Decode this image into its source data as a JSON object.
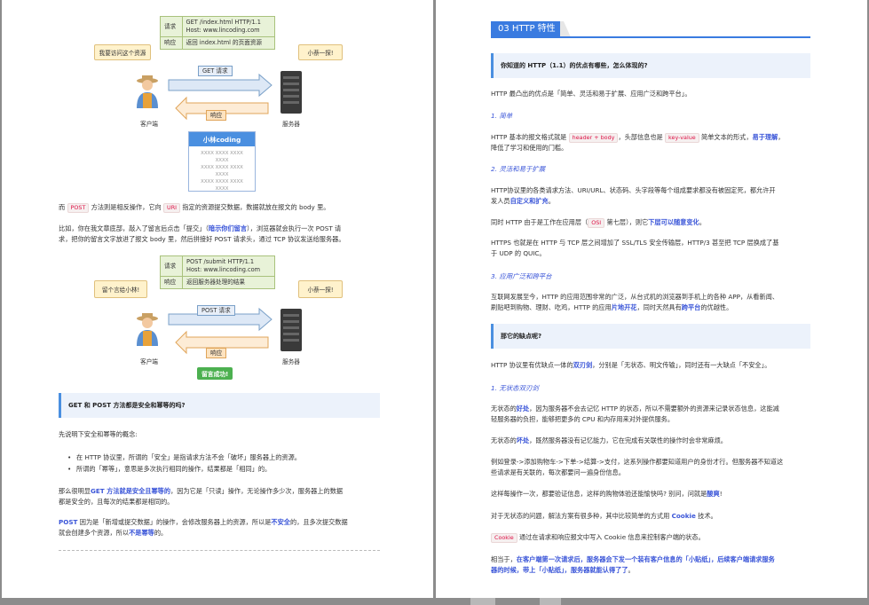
{
  "left": {
    "diag1": {
      "req_label": "请求",
      "req_text1": "GET /index.html HTTP/1.1",
      "req_text2": "Host:  www.lincoding.com",
      "resp_label": "响应",
      "resp_text": "返回 index.html 的页面资源",
      "bubble_left": "我要访问这个资源",
      "bubble_right": "小萘一探!",
      "arrow_tag": "GET 请求",
      "resp_tag": "响应",
      "client": "客户端",
      "server": "服务器",
      "card_title": "小林coding",
      "card_lines": [
        "XXXX XXXX XXXX XXXX",
        "XXXX XXXX XXXX XXXX",
        "XXXX XXXX XXXX XXXX"
      ]
    },
    "p1_a": "而",
    "p1_code1": "POST",
    "p1_b": "方法则是相反操作，它向",
    "p1_code2": "URI",
    "p1_c": "指定的资源提交数据，数据就放在报文的 body 里。",
    "p2_line1_a": "比如，你在我文章底部，敲入了留言后点击「提交」（",
    "p2_line1_b": "暗示你们留言",
    "p2_line1_c": "），浏览器就会执行一次 POST 请",
    "p2_line2": "求，把你的留言文字放进了报文 body 里，然后拼接好 POST 请求头，通过 TCP 协议发送给服务器。",
    "diag2": {
      "req_label": "请求",
      "req_text1": "POST /submit HTTP/1.1",
      "req_text2": "Host:  www.lincoding.com",
      "resp_label": "响应",
      "resp_text": "返回服务器处理的结果",
      "bubble_left": "留个言给小林!",
      "bubble_right": "小萘一探!",
      "arrow_tag": "POST 请求",
      "resp_tag": "响应",
      "client": "客户端",
      "server": "服务器",
      "success": "留言成功!"
    },
    "quote": "GET 和 POST 方法都是安全和幂等的吗?",
    "p3": "先说明下安全和幂等的概念:",
    "bullet1": "在 HTTP 协议里，所谓的「安全」是指请求方法不会「破坏」服务器上的资源。",
    "bullet2": "所谓的「幂等」，意思是多次执行相同的操作，结果都是「相同」的。",
    "p4_a": "那么很明显",
    "p4_b": "GET 方法就是安全且幂等的",
    "p4_c": "，因为它是「只读」操作，无论操作多少次，服务器上的数据",
    "p4_line2": "都是安全的，且每次的结果都是相同的。",
    "p5_a": "POST",
    "p5_b": "因为是「新增或提交数据」的操作，会修改服务器上的资源，所以是",
    "p5_c": "不安全",
    "p5_d": "的，且多次提交数据",
    "p5_line2_a": "就会创建多个资源，所以",
    "p5_line2_b": "不是幂等",
    "p5_line2_c": "的。"
  },
  "right": {
    "section_title": "03 HTTP 特性",
    "quote1": "你知道的 HTTP（1.1）的优点有哪些，怎么体现的?",
    "r1": "HTTP 最凸出的优点是「简单、灵活和易于扩展、应用广泛和跨平台」。",
    "h1": "1. 简单",
    "r2_a": "HTTP 基本的报文格式就是",
    "r2_code1": "header + body",
    "r2_b": "，头部信息也是",
    "r2_code2": "key-value",
    "r2_c": "简单文本的形式，",
    "r2_d": "易于理解",
    "r2_e": "，",
    "r2_line2": "降低了学习和使用的门槛。",
    "h2": "2. 灵活和易于扩展",
    "r3_line1": "HTTP协议里的各类请求方法、URI/URL、状态码、头字段等每个组成要求都没有被固定死，都允许开",
    "r3_line2_a": "发人员",
    "r3_line2_b": "自定义和扩充",
    "r3_line2_c": "。",
    "r4_a": "同时 HTTP 由于是工作在应用层（",
    "r4_code": "OSI",
    "r4_b": "第七层），则它",
    "r4_c": "下层可以随意变化",
    "r4_d": "。",
    "r5_line1": "HTTPS 也就是在 HTTP 与 TCP 层之间增加了 SSL/TLS 安全传输层，HTTP/3 甚至把 TCP 层换成了基",
    "r5_line2": "于 UDP 的 QUIC。",
    "h3": "3. 应用广泛和跨平台",
    "r6_line1": "互联网发展至今，HTTP 的应用范围非常的广泛，从台式机的浏览器到手机上的各种 APP，从看新闻、",
    "r6_line2_a": "刷贴吧到购物、理财、吃鸡，HTTP 的应用",
    "r6_line2_b": "片地开花",
    "r6_line2_c": "，同时天然具有",
    "r6_line2_d": "跨平台",
    "r6_line2_e": "的优越性。",
    "quote2": "那它的缺点呢?",
    "r7_a": "HTTP 协议里有优缺点一体的",
    "r7_b": "双刃剑",
    "r7_c": "，分别是「无状态、明文传输」，同时还有一大缺点「不安全」。",
    "h4": "1. 无状态双刃剑",
    "r8_line1_a": "无状态的",
    "r8_line1_b": "好处",
    "r8_line1_c": "，因为服务器不会去记忆 HTTP 的状态，所以不需要额外的资源来记录状态信息，这能减",
    "r8_line2": "轻服务器的负担，能够把更多的 CPU 和内存用来对外提供服务。",
    "r9_a": "无状态的",
    "r9_b": "坏处",
    "r9_c": "，既然服务器没有记忆能力，它在完成有关联性的操作时会非常麻烦。",
    "r10_line1": "例如登录->添加购物车->下单->结算->支付，这系列操作都要知道用户的身份才行。但服务器不知道这",
    "r10_line2": "些请求是有关联的，每次都要问一遍身份信息。",
    "r11_a": "这样每操作一次，都要验证信息，这样的购物体验还能愉快吗? 别问，问就是",
    "r11_b": "酸爽",
    "r11_c": "!",
    "r12_a": "对于无状态的问题，解法方案有很多种，其中比较简单的方式用",
    "r12_b": "Cookie",
    "r12_c": "技术。",
    "r13_code": "Cookie",
    "r13_b": "通过在请求和响应报文中写入 Cookie 信息来控制客户端的状态。",
    "r14_line1_a": "相当于，",
    "r14_line1_b": "在客户端第一次请求后，服务器会下发一个装有客户信息的「小贴纸」，后续客户端请求服务",
    "r14_line2_a": "器的时候，带上「小贴纸」，服务器就能认得了了",
    "r14_line2_b": "。"
  }
}
